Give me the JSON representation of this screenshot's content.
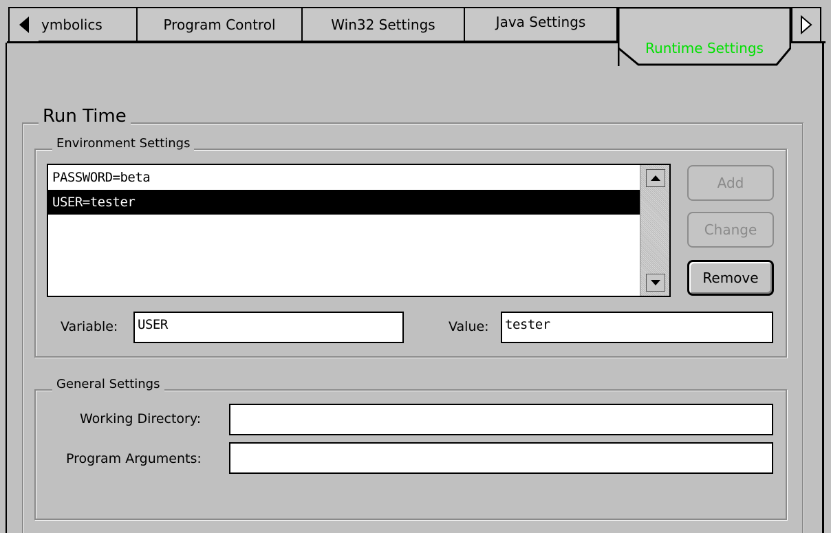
{
  "tabs": [
    {
      "label": "ymbolics",
      "active": false
    },
    {
      "label": "Program Control",
      "active": false
    },
    {
      "label": "Win32 Settings",
      "active": false
    },
    {
      "label": "Java Settings",
      "active": false
    },
    {
      "label": "Runtime Settings",
      "active": true
    }
  ],
  "colors": {
    "active_tab_text": "#00e000",
    "background": "#c0c0c0"
  },
  "icons": {
    "scroll_left": "triangle-left-icon",
    "scroll_right": "triangle-right-icon",
    "scroll_up": "arrow-up-icon",
    "scroll_down": "arrow-down-icon"
  },
  "runtime": {
    "title": "Run Time",
    "environment": {
      "title": "Environment Settings",
      "items": [
        "PASSWORD=beta",
        "USER=tester"
      ],
      "selected_index": 1,
      "buttons": {
        "add": "Add",
        "change": "Change",
        "remove": "Remove"
      },
      "variable_label": "Variable:",
      "variable_value": "USER",
      "value_label": "Value:",
      "value_value": "tester"
    },
    "general": {
      "title": "General Settings",
      "working_directory_label": "Working Directory:",
      "working_directory_value": "",
      "program_arguments_label": "Program Arguments:",
      "program_arguments_value": ""
    }
  }
}
